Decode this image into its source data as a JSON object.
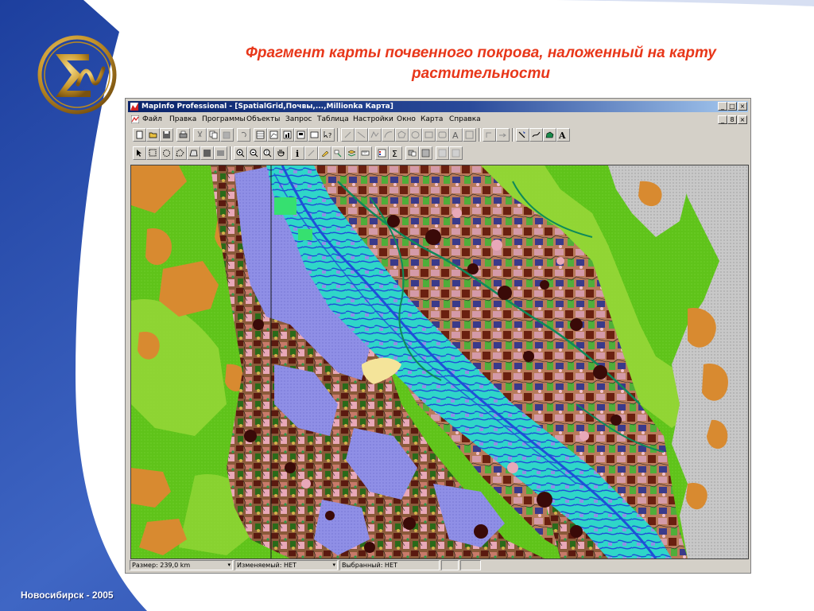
{
  "slide": {
    "title": "Фрагмент карты почвенного покрова, наложенный на карту растительности",
    "footer": "Новосибирск - 2005"
  },
  "window": {
    "title": "MapInfo Professional - [SpatialGrid,Почвы,...,Millionka Карта]",
    "title_controls": [
      "_",
      "□",
      "×"
    ],
    "doc_controls": [
      "_",
      "8",
      "×"
    ]
  },
  "menu": [
    "Файл",
    "Правка",
    "Программы",
    "Объекты",
    "Запрос",
    "Таблица",
    "Настройки",
    "Окно",
    "Карта",
    "Справка"
  ],
  "status": {
    "size": "Размер: 239,0 km",
    "changed": "Изменяемый: НЕТ",
    "selected": "Выбранный: НЕТ"
  },
  "colors": {
    "title_red": "#e8371a",
    "bg_blue": "#2c4fb0",
    "logo_gold": "#c8962a",
    "map_green": "#5fc31a",
    "river_blue": "#1f4fd8",
    "river_cyan": "#2fd6c8",
    "soil_purple": "#8a8ee8",
    "soil_brown": "#7a3a1a",
    "mountain_gray": "#c8c8c8",
    "sand_orange": "#d88a30"
  }
}
